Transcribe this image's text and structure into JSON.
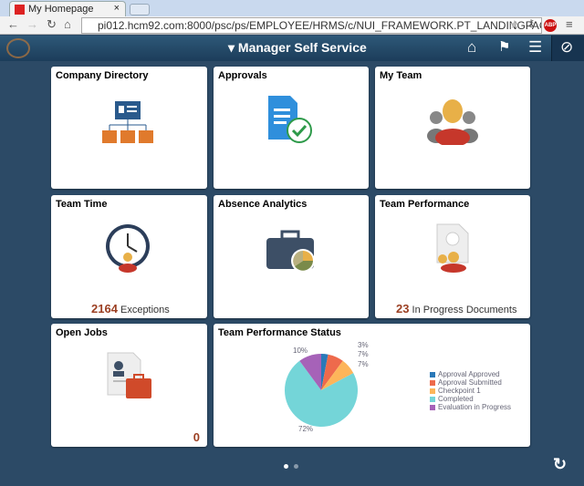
{
  "browser": {
    "tab_title": "My Homepage",
    "tab_close": "×",
    "url": "pi012.hcm92.com:8000/psc/ps/EMPLOYEE/HRMS/c/NUI_FRAMEWORK.PT_LANDINGPAGE.GBL",
    "abp": "ABP"
  },
  "header": {
    "title": "▾ Manager Self Service"
  },
  "tiles": [
    {
      "title": "Company Directory"
    },
    {
      "title": "Approvals"
    },
    {
      "title": "My Team"
    },
    {
      "title": "Team Time",
      "count": "2164",
      "count_label": "Exceptions"
    },
    {
      "title": "Absence Analytics"
    },
    {
      "title": "Team Performance",
      "count": "23",
      "count_label": "In Progress Documents"
    },
    {
      "title": "Open Jobs",
      "count": "0"
    },
    {
      "title": "Team Performance Status"
    }
  ],
  "chart_data": {
    "type": "pie",
    "title": "Team Performance Status",
    "categories": [
      "Approval Approved",
      "Approval Submitted",
      "Checkpoint 1",
      "Completed",
      "Evaluation in Progress"
    ],
    "values": [
      3,
      7,
      7,
      72,
      10
    ],
    "labels": [
      "3%",
      "7%",
      "7%",
      "72%",
      "10%"
    ],
    "colors": [
      "#2a79b8",
      "#ee6a4c",
      "#fdb55a",
      "#74d5d8",
      "#a662b8"
    ],
    "legend": "right"
  }
}
